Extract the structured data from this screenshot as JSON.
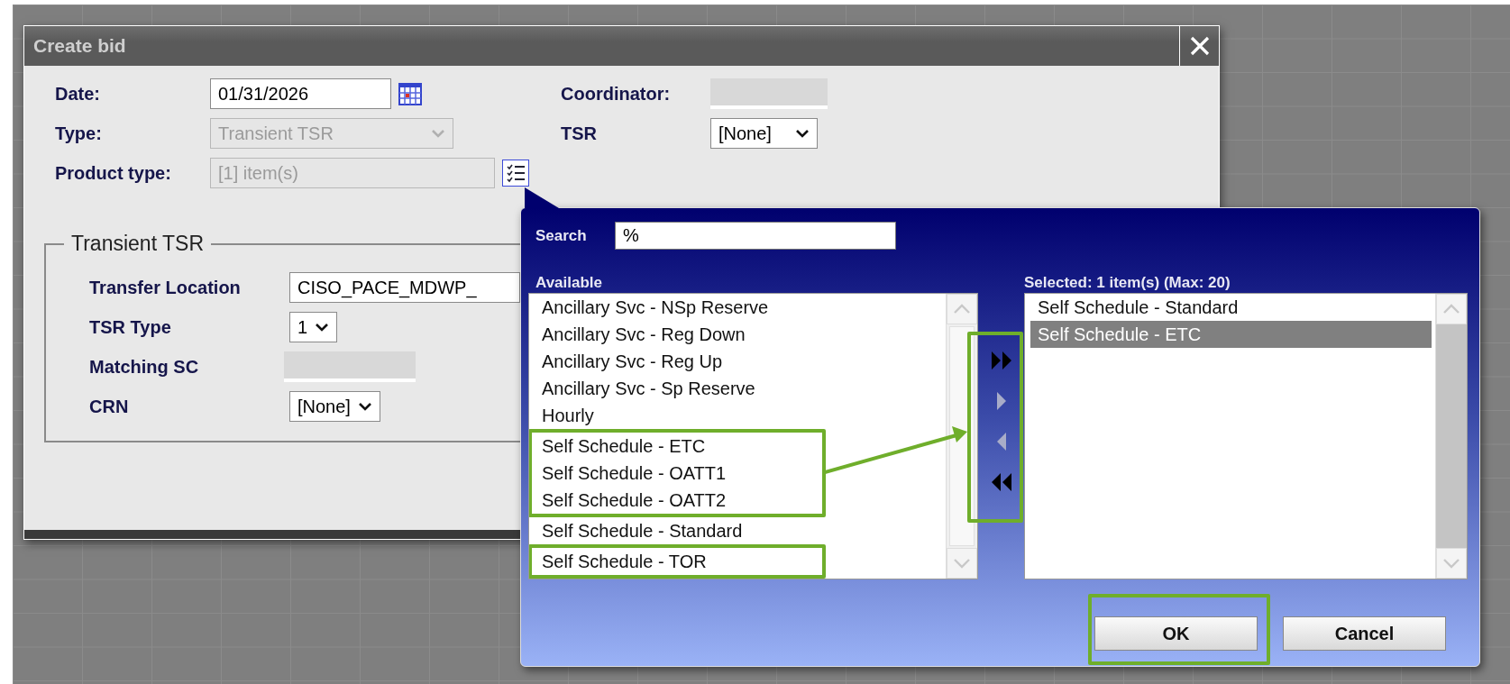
{
  "dialog": {
    "title": "Create bid",
    "left_fields": [
      {
        "label": "Date:",
        "kind": "date",
        "value": "01/31/2026",
        "disabled": false
      },
      {
        "label": "Type:",
        "kind": "select",
        "value": "Transient TSR",
        "disabled": true
      },
      {
        "label": "Product type:",
        "kind": "picker",
        "value": "[1] item(s)",
        "disabled": true
      }
    ],
    "right_fields": [
      {
        "label": "Coordinator:",
        "kind": "redacted"
      },
      {
        "label": "TSR",
        "kind": "select",
        "value": "[None]"
      }
    ],
    "section": {
      "legend": "Transient TSR",
      "fields": [
        {
          "label": "Transfer Location",
          "kind": "text",
          "value": "CISO_PACE_MDWP_"
        },
        {
          "label": "TSR Type",
          "kind": "select",
          "value": "1"
        },
        {
          "label": "Matching SC",
          "kind": "redacted"
        },
        {
          "label": "CRN",
          "kind": "select",
          "value": "[None]"
        }
      ]
    }
  },
  "picker": {
    "search_label": "Search",
    "search_value": "%",
    "available_label": "Available",
    "available": [
      {
        "label": "Ancillary Svc - NSp Reserve",
        "selected": false
      },
      {
        "label": "Ancillary Svc - Reg Down",
        "selected": false
      },
      {
        "label": "Ancillary Svc - Reg Up",
        "selected": false
      },
      {
        "label": "Ancillary Svc - Sp Reserve",
        "selected": false
      },
      {
        "label": "Hourly",
        "selected": false
      },
      {
        "label": "Self Schedule - ETC",
        "selected": false,
        "highlighted": true
      },
      {
        "label": "Self Schedule - OATT1",
        "selected": false,
        "highlighted": true
      },
      {
        "label": "Self Schedule - OATT2",
        "selected": false,
        "highlighted": true
      },
      {
        "label": "Self Schedule - Standard",
        "selected": false
      },
      {
        "label": "Self Schedule - TOR",
        "selected": false,
        "highlighted": true
      }
    ],
    "selected_label": "Selected: 1 item(s) (Max: 20)",
    "selected_items": [
      {
        "label": "Self Schedule - Standard",
        "selected": false
      },
      {
        "label": "Self Schedule - ETC",
        "selected": true
      }
    ],
    "move_buttons": [
      {
        "kind": "add_all",
        "disabled": false
      },
      {
        "kind": "add",
        "disabled": true
      },
      {
        "kind": "remove",
        "disabled": true
      },
      {
        "kind": "remove_all",
        "disabled": false
      }
    ],
    "buttons": [
      {
        "label": "OK"
      },
      {
        "label": "Cancel"
      }
    ]
  }
}
